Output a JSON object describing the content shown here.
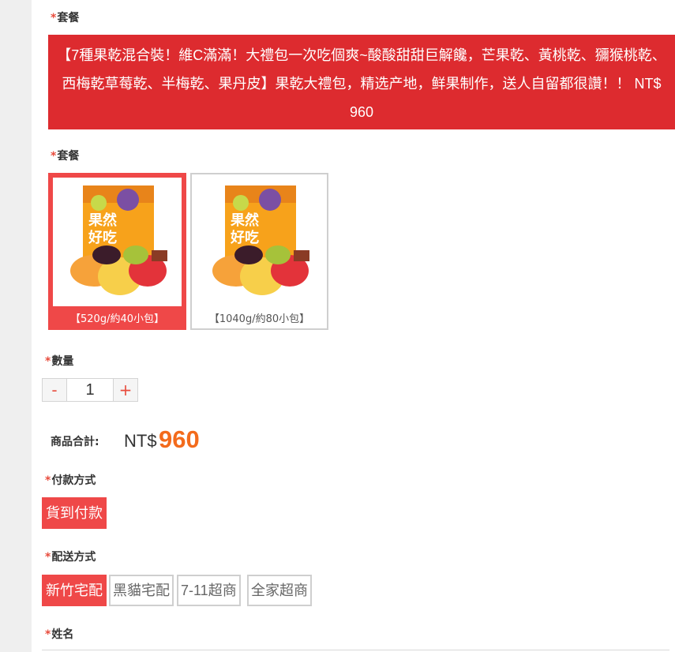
{
  "package_section": {
    "label": "套餐",
    "description": "【7種果乾混合裝！維C滿滿！大禮包一次吃個爽~酸酸甜甜巨解饞，芒果乾、黃桃乾、獼猴桃乾、西梅乾草莓乾、半梅乾、果丹皮】果乾大禮包，精选产地，鲜果制作，送人自留都很讚！！ NT$ 960"
  },
  "option_section": {
    "label": "套餐",
    "options": [
      {
        "caption": "【520g/約40小包】",
        "selected": true
      },
      {
        "caption": "【1040g/約80小包】",
        "selected": false
      }
    ],
    "product_package_text": [
      "果然",
      "好吃"
    ]
  },
  "quantity": {
    "label": "數量",
    "minus": "-",
    "value": "1",
    "plus": "+"
  },
  "total": {
    "label": "商品合計:",
    "prefix": "NT$",
    "value": "960"
  },
  "payment": {
    "label": "付款方式",
    "options": [
      {
        "label": "貨到付款",
        "selected": true
      }
    ]
  },
  "shipping": {
    "label": "配送方式",
    "options": [
      {
        "label": "新竹宅配",
        "selected": true
      },
      {
        "label": "黑貓宅配",
        "selected": false
      },
      {
        "label": "7-11超商",
        "selected": false
      },
      {
        "label": "全家超商",
        "selected": false
      }
    ]
  },
  "name_field": {
    "label": "姓名"
  },
  "required_mark": "*",
  "colors": {
    "accent": "#ef4848",
    "banner": "#dd2b2f",
    "price": "#f36b1c"
  }
}
